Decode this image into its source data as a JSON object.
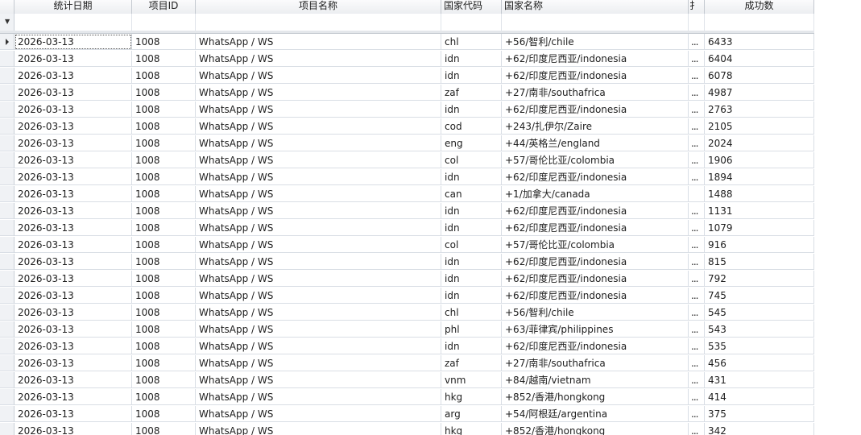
{
  "columns": [
    {
      "key": "date",
      "label": "统计日期"
    },
    {
      "key": "project_id",
      "label": "项目ID"
    },
    {
      "key": "project_name",
      "label": "项目名称"
    },
    {
      "key": "country_code",
      "label": "国家代码"
    },
    {
      "key": "country_name",
      "label": "国家名称"
    },
    {
      "key": "truncated",
      "label": "扌"
    },
    {
      "key": "success",
      "label": "成功数"
    }
  ],
  "filter_icon": "funnel-icon",
  "row_indicator_icon": "triangle-right-icon",
  "rows": [
    {
      "date": "2026-03-13",
      "project_id": "1008",
      "project_name": "WhatsApp / WS",
      "country_code": "chl",
      "country_name": "+56/智利/chile",
      "truncated": "...",
      "success": "6433"
    },
    {
      "date": "2026-03-13",
      "project_id": "1008",
      "project_name": "WhatsApp / WS",
      "country_code": "idn",
      "country_name": "+62/印度尼西亚/indonesia",
      "truncated": "...",
      "success": "6404"
    },
    {
      "date": "2026-03-13",
      "project_id": "1008",
      "project_name": "WhatsApp / WS",
      "country_code": "idn",
      "country_name": "+62/印度尼西亚/indonesia",
      "truncated": "...",
      "success": "6078"
    },
    {
      "date": "2026-03-13",
      "project_id": "1008",
      "project_name": "WhatsApp / WS",
      "country_code": "zaf",
      "country_name": "+27/南非/southafrica",
      "truncated": "...",
      "success": "4987"
    },
    {
      "date": "2026-03-13",
      "project_id": "1008",
      "project_name": "WhatsApp / WS",
      "country_code": "idn",
      "country_name": "+62/印度尼西亚/indonesia",
      "truncated": "...",
      "success": "2763"
    },
    {
      "date": "2026-03-13",
      "project_id": "1008",
      "project_name": "WhatsApp / WS",
      "country_code": "cod",
      "country_name": "+243/扎伊尔/Zaire",
      "truncated": "...",
      "success": "2105"
    },
    {
      "date": "2026-03-13",
      "project_id": "1008",
      "project_name": "WhatsApp / WS",
      "country_code": "eng",
      "country_name": "+44/英格兰/england",
      "truncated": "...",
      "success": "2024"
    },
    {
      "date": "2026-03-13",
      "project_id": "1008",
      "project_name": "WhatsApp / WS",
      "country_code": "col",
      "country_name": "+57/哥伦比亚/colombia",
      "truncated": "...",
      "success": "1906"
    },
    {
      "date": "2026-03-13",
      "project_id": "1008",
      "project_name": "WhatsApp / WS",
      "country_code": "idn",
      "country_name": "+62/印度尼西亚/indonesia",
      "truncated": "...",
      "success": "1894"
    },
    {
      "date": "2026-03-13",
      "project_id": "1008",
      "project_name": "WhatsApp / WS",
      "country_code": "can",
      "country_name": "+1/加拿大/canada",
      "truncated": "",
      "success": "1488"
    },
    {
      "date": "2026-03-13",
      "project_id": "1008",
      "project_name": "WhatsApp / WS",
      "country_code": "idn",
      "country_name": "+62/印度尼西亚/indonesia",
      "truncated": "...",
      "success": "1131"
    },
    {
      "date": "2026-03-13",
      "project_id": "1008",
      "project_name": "WhatsApp / WS",
      "country_code": "idn",
      "country_name": "+62/印度尼西亚/indonesia",
      "truncated": "...",
      "success": "1079"
    },
    {
      "date": "2026-03-13",
      "project_id": "1008",
      "project_name": "WhatsApp / WS",
      "country_code": "col",
      "country_name": "+57/哥伦比亚/colombia",
      "truncated": "...",
      "success": "916"
    },
    {
      "date": "2026-03-13",
      "project_id": "1008",
      "project_name": "WhatsApp / WS",
      "country_code": "idn",
      "country_name": "+62/印度尼西亚/indonesia",
      "truncated": "...",
      "success": "815"
    },
    {
      "date": "2026-03-13",
      "project_id": "1008",
      "project_name": "WhatsApp / WS",
      "country_code": "idn",
      "country_name": "+62/印度尼西亚/indonesia",
      "truncated": "...",
      "success": "792"
    },
    {
      "date": "2026-03-13",
      "project_id": "1008",
      "project_name": "WhatsApp / WS",
      "country_code": "idn",
      "country_name": "+62/印度尼西亚/indonesia",
      "truncated": "...",
      "success": "745"
    },
    {
      "date": "2026-03-13",
      "project_id": "1008",
      "project_name": "WhatsApp / WS",
      "country_code": "chl",
      "country_name": "+56/智利/chile",
      "truncated": "...",
      "success": "545"
    },
    {
      "date": "2026-03-13",
      "project_id": "1008",
      "project_name": "WhatsApp / WS",
      "country_code": "phl",
      "country_name": "+63/菲律宾/philippines",
      "truncated": "...",
      "success": "543"
    },
    {
      "date": "2026-03-13",
      "project_id": "1008",
      "project_name": "WhatsApp / WS",
      "country_code": "idn",
      "country_name": "+62/印度尼西亚/indonesia",
      "truncated": "...",
      "success": "535"
    },
    {
      "date": "2026-03-13",
      "project_id": "1008",
      "project_name": "WhatsApp / WS",
      "country_code": "zaf",
      "country_name": "+27/南非/southafrica",
      "truncated": "...",
      "success": "456"
    },
    {
      "date": "2026-03-13",
      "project_id": "1008",
      "project_name": "WhatsApp / WS",
      "country_code": "vnm",
      "country_name": "+84/越南/vietnam",
      "truncated": "...",
      "success": "431"
    },
    {
      "date": "2026-03-13",
      "project_id": "1008",
      "project_name": "WhatsApp / WS",
      "country_code": "hkg",
      "country_name": "+852/香港/hongkong",
      "truncated": "...",
      "success": "414"
    },
    {
      "date": "2026-03-13",
      "project_id": "1008",
      "project_name": "WhatsApp / WS",
      "country_code": "arg",
      "country_name": "+54/阿根廷/argentina",
      "truncated": "...",
      "success": "375"
    },
    {
      "date": "2026-03-13",
      "project_id": "1008",
      "project_name": "WhatsApp / WS",
      "country_code": "hkg",
      "country_name": "+852/香港/hongkong",
      "truncated": "...",
      "success": "342"
    }
  ]
}
